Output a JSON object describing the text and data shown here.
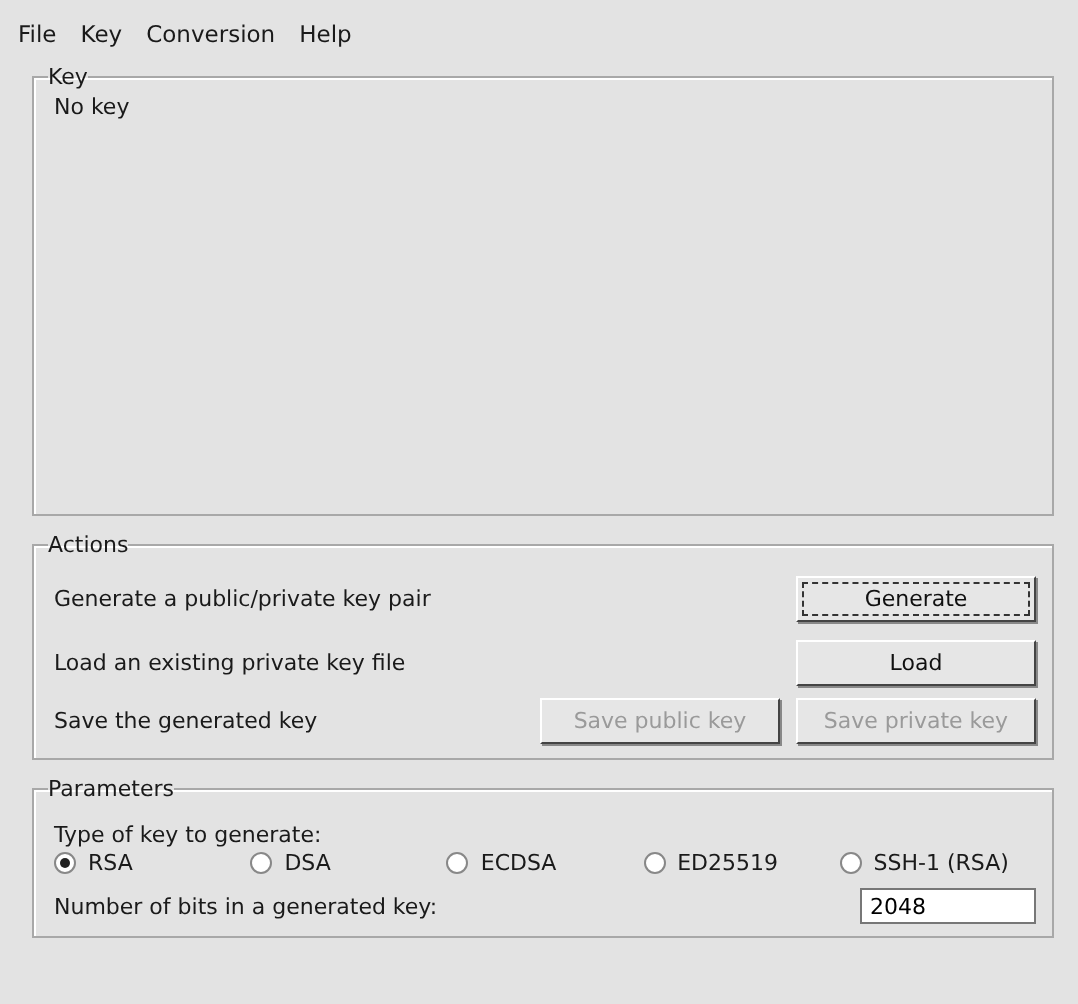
{
  "menu": [
    {
      "label": "File"
    },
    {
      "label": "Key"
    },
    {
      "label": "Conversion"
    },
    {
      "label": "Help"
    }
  ],
  "key_group": {
    "title": "Key",
    "text": "No key"
  },
  "actions": {
    "title": "Actions",
    "rows": [
      {
        "label": "Generate a public/private key pair",
        "buttons": [
          {
            "label": "Generate",
            "disabled": false,
            "focused": true
          }
        ]
      },
      {
        "label": "Load an existing private key file",
        "buttons": [
          {
            "label": "Load",
            "disabled": false,
            "focused": false
          }
        ]
      },
      {
        "label": "Save the generated key",
        "buttons": [
          {
            "label": "Save public key",
            "disabled": true,
            "focused": false
          },
          {
            "label": "Save private key",
            "disabled": true,
            "focused": false
          }
        ]
      }
    ]
  },
  "parameters": {
    "title": "Parameters",
    "type_label": "Type of key to generate:",
    "key_types": [
      {
        "label": "RSA",
        "selected": true
      },
      {
        "label": "DSA",
        "selected": false
      },
      {
        "label": "ECDSA",
        "selected": false
      },
      {
        "label": "ED25519",
        "selected": false
      },
      {
        "label": "SSH-1 (RSA)",
        "selected": false
      }
    ],
    "bits_label": "Number of bits in a generated key:",
    "bits_value": "2048"
  }
}
